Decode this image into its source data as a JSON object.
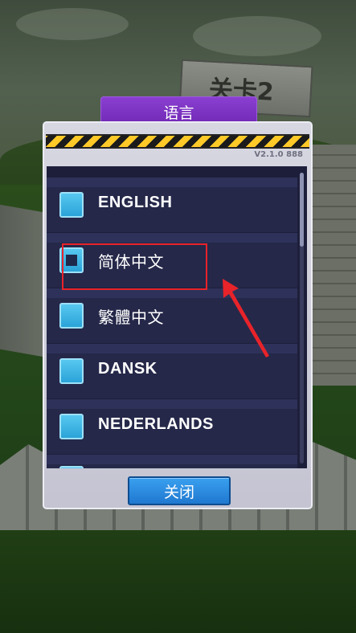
{
  "background": {
    "level_sign": "关卡2"
  },
  "dialog": {
    "title": "语言",
    "version": "V2.1.0 888",
    "close_label": "关闭",
    "languages": [
      {
        "label": "ENGLISH",
        "checked": false
      },
      {
        "label": "简体中文",
        "checked": true
      },
      {
        "label": "繁體中文",
        "checked": false
      },
      {
        "label": "DANSK",
        "checked": false
      },
      {
        "label": "NEDERLANDS",
        "checked": false
      }
    ]
  },
  "colors": {
    "title_tab": "#7a30c0",
    "list_bg": "#1d1f3a",
    "checkbox": "#3db4e6",
    "close_button": "#2b8be0",
    "annotation": "#e8232a"
  }
}
